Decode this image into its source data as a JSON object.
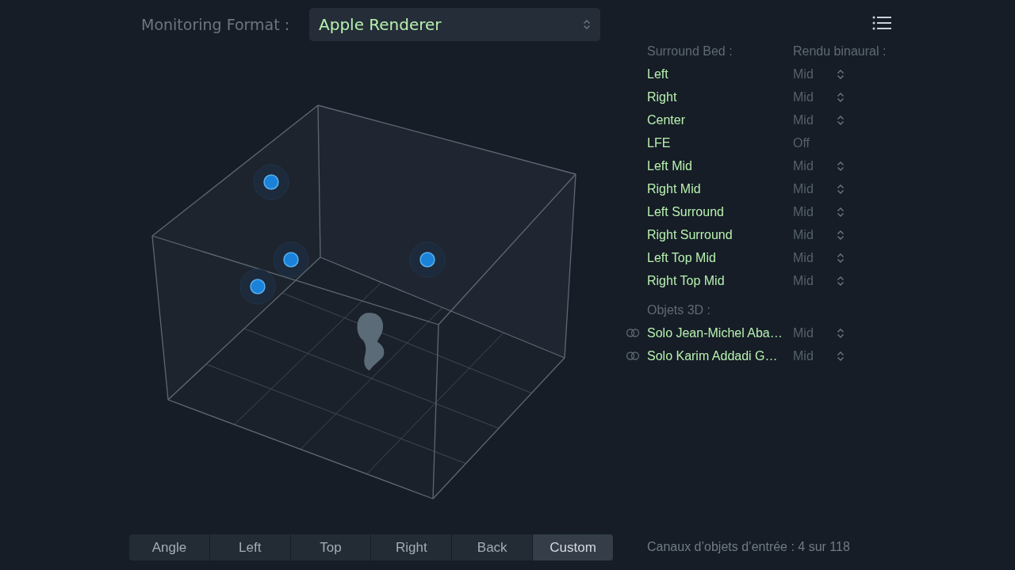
{
  "monitoring_format": {
    "label": "Monitoring Format :",
    "value": "Apple Renderer"
  },
  "surround_bed": {
    "heading": "Surround Bed :",
    "column_heading": "Rendu binaural :",
    "rows": [
      {
        "name": "Left",
        "mode": "Mid",
        "adjustable": true
      },
      {
        "name": "Right",
        "mode": "Mid",
        "adjustable": true
      },
      {
        "name": "Center",
        "mode": "Mid",
        "adjustable": true
      },
      {
        "name": "LFE",
        "mode": "Off",
        "adjustable": false
      },
      {
        "name": "Left Mid",
        "mode": "Mid",
        "adjustable": true
      },
      {
        "name": "Right Mid",
        "mode": "Mid",
        "adjustable": true
      },
      {
        "name": "Left Surround",
        "mode": "Mid",
        "adjustable": true
      },
      {
        "name": "Right Surround",
        "mode": "Mid",
        "adjustable": true
      },
      {
        "name": "Left Top Mid",
        "mode": "Mid",
        "adjustable": true
      },
      {
        "name": "Right Top Mid",
        "mode": "Mid",
        "adjustable": true
      }
    ]
  },
  "objects_3d": {
    "heading": "Objets 3D :",
    "rows": [
      {
        "name": "Solo Jean-Michel Aba…",
        "mode": "Mid",
        "adjustable": true
      },
      {
        "name": "Solo Karim Addadi G…",
        "mode": "Mid",
        "adjustable": true
      }
    ]
  },
  "view_tabs": [
    {
      "label": "Angle",
      "selected": false
    },
    {
      "label": "Left",
      "selected": false
    },
    {
      "label": "Top",
      "selected": false
    },
    {
      "label": "Right",
      "selected": false
    },
    {
      "label": "Back",
      "selected": false
    },
    {
      "label": "Custom",
      "selected": true
    }
  ],
  "status": "Canaux d’objets d’entrée : 4 sur 118"
}
